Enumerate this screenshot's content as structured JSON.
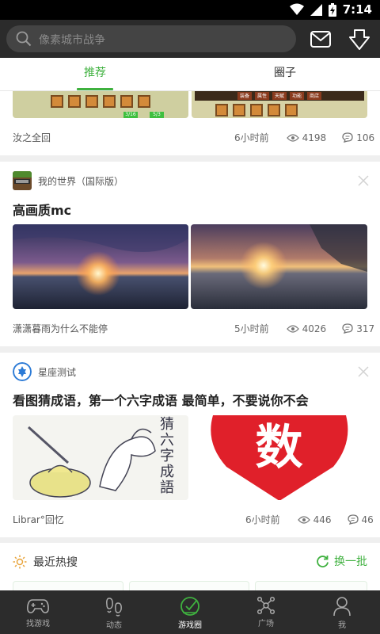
{
  "status_bar": {
    "time": "7:14"
  },
  "search": {
    "placeholder": "像素城市战争"
  },
  "tabs": [
    {
      "label": "推荐",
      "active": true
    },
    {
      "label": "圈子",
      "active": false
    }
  ],
  "posts": [
    {
      "author": "汝之全回",
      "time_ago": "6小时前",
      "views": "4198",
      "comments": "106",
      "thumb_labels": [
        "装备",
        "属性",
        "天赋",
        "功能",
        "商店"
      ],
      "thumb_counts": [
        "3/16",
        "5/3"
      ]
    },
    {
      "circle": "我的世界（国际版）",
      "title": "高画质mc",
      "author": "潇潇暮雨为什么不能停",
      "time_ago": "5小时前",
      "views": "4026",
      "comments": "317"
    },
    {
      "circle": "星座测试",
      "title": "看图猜成语，第一个六字成语 最简单，不要说你不会",
      "author": "Librar°回忆",
      "time_ago": "6小时前",
      "views": "446",
      "comments": "46",
      "image_text": {
        "sketch": "猜六字成語",
        "heart": "数"
      }
    }
  ],
  "hot_search": {
    "title": "最近热搜",
    "refresh_label": "换一批"
  },
  "bottom_nav": [
    {
      "label": "找游戏",
      "icon": "gamepad-icon",
      "active": false
    },
    {
      "label": "动态",
      "icon": "footprint-icon",
      "active": false
    },
    {
      "label": "游戏圈",
      "icon": "game-circle-icon",
      "active": true
    },
    {
      "label": "广场",
      "icon": "network-icon",
      "active": false
    },
    {
      "label": "我",
      "icon": "person-icon",
      "active": false
    }
  ],
  "colors": {
    "accent": "#3fb13f",
    "top_bar": "#2b2b2b",
    "bottom_nav": "#2c2c2c"
  }
}
